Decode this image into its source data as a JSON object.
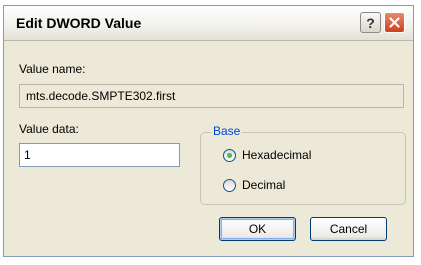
{
  "window": {
    "title": "Edit DWORD Value",
    "help_glyph": "?",
    "close_icon": "close-x-icon",
    "close_color": "#c9401e"
  },
  "form": {
    "value_name_label": "Value name:",
    "value_name": "mts.decode.SMPTE302.first",
    "value_data_label": "Value data:",
    "value_data": "1",
    "base_label": "Base",
    "base_options": [
      {
        "label": "Hexadecimal",
        "selected": true
      },
      {
        "label": "Decimal",
        "selected": false
      }
    ]
  },
  "buttons": {
    "ok": "OK",
    "cancel": "Cancel"
  },
  "colors": {
    "accent": "#0046d5",
    "dialog_bg": "#ece9d8"
  }
}
